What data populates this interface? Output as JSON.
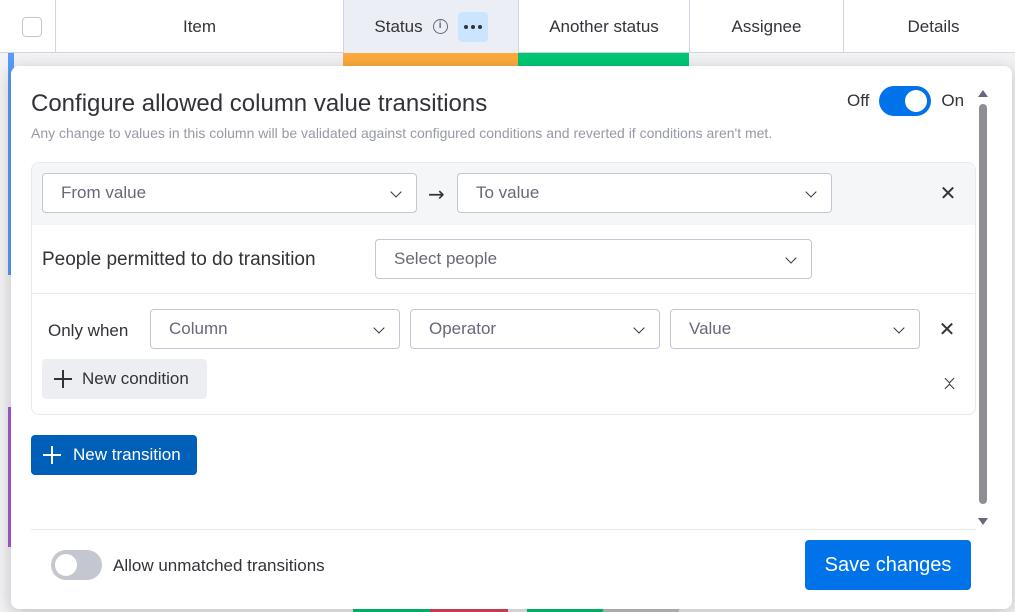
{
  "board": {
    "columns": [
      "Item",
      "Status",
      "Another status",
      "Assignee",
      "Details"
    ]
  },
  "modal": {
    "title": "Configure allowed column value transitions",
    "subtitle": "Any change to values in this column will be validated against configured conditions and reverted if conditions aren't met.",
    "toggle": {
      "off_label": "Off",
      "on_label": "On",
      "enabled": true
    },
    "transition": {
      "from_placeholder": "From value",
      "to_placeholder": "To value",
      "people_label": "People permitted to do transition",
      "people_placeholder": "Select people",
      "condition": {
        "label": "Only when",
        "column_placeholder": "Column",
        "operator_placeholder": "Operator",
        "value_placeholder": "Value"
      },
      "new_condition_label": "New condition"
    },
    "new_transition_label": "New transition",
    "footer": {
      "allow_unmatched_label": "Allow unmatched transitions",
      "allow_unmatched_enabled": false,
      "save_label": "Save changes"
    }
  },
  "colors": {
    "accent": "#0073ea",
    "status_orange": "#fdab3d",
    "status_green": "#00c875",
    "status_red": "#e2445c",
    "group_blue": "#579bfc",
    "group_purple": "#a25ddc"
  }
}
